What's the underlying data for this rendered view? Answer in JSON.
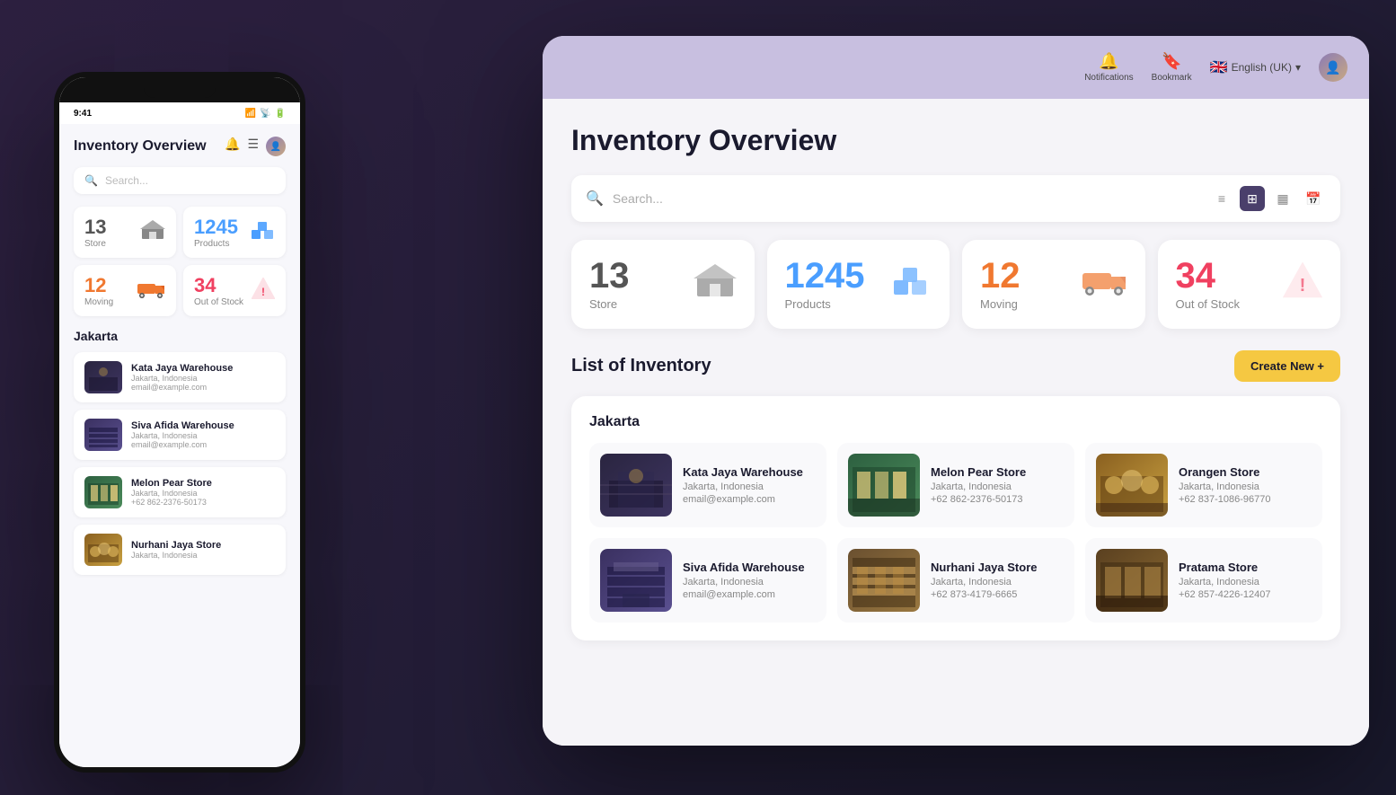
{
  "scene": {
    "background": "#1a1a2e"
  },
  "desktop": {
    "header": {
      "notifications_label": "Notifications",
      "bookmark_label": "Bookmark",
      "language": "English (UK)",
      "language_flag": "🇬🇧"
    },
    "page_title": "Inventory Overview",
    "search_placeholder": "Search...",
    "view_modes": [
      "list",
      "grid",
      "table",
      "calendar"
    ],
    "stats": [
      {
        "id": "store",
        "number": "13",
        "label": "Store",
        "color": "gray",
        "icon": "🏭"
      },
      {
        "id": "products",
        "number": "1245",
        "label": "Products",
        "color": "blue",
        "icon": "📦"
      },
      {
        "id": "moving",
        "number": "12",
        "label": "Moving",
        "color": "orange",
        "icon": "🚚"
      },
      {
        "id": "out-of-stock",
        "number": "34",
        "label": "Out of Stock",
        "color": "red",
        "icon": "⚠️"
      }
    ],
    "list_title": "List of Inventory",
    "create_button": "Create New +",
    "region": "Jakarta",
    "inventory_items": [
      {
        "id": 1,
        "name": "Kata Jaya Warehouse",
        "location": "Jakarta, Indonesia",
        "contact": "email@example.com",
        "thumb_type": "warehouse"
      },
      {
        "id": 2,
        "name": "Melon Pear Store",
        "location": "Jakarta, Indonesia",
        "contact": "+62 862-2376-50173",
        "thumb_type": "store"
      },
      {
        "id": 3,
        "name": "Orangen Store",
        "location": "Jakarta, Indonesia",
        "contact": "+62 837-1086-96770",
        "thumb_type": "market"
      },
      {
        "id": 4,
        "name": "Siva Afida Warehouse",
        "location": "Jakarta, Indonesia",
        "contact": "email@example.com",
        "thumb_type": "warehouse2"
      },
      {
        "id": 5,
        "name": "Nurhani Jaya Store",
        "location": "Jakarta, Indonesia",
        "contact": "+62 873-4179-6665",
        "thumb_type": "shelves"
      },
      {
        "id": 6,
        "name": "Pratama Store",
        "location": "Jakarta, Indonesia",
        "contact": "+62 857-4226-12407",
        "thumb_type": "market2"
      }
    ]
  },
  "mobile": {
    "page_title": "Inventory Overview",
    "search_placeholder": "Search...",
    "stats": [
      {
        "id": "store",
        "number": "13",
        "label": "Store",
        "color": "gray",
        "icon": "🏭"
      },
      {
        "id": "products",
        "number": "1245",
        "label": "Products",
        "color": "blue",
        "icon": "📦"
      },
      {
        "id": "moving",
        "number": "12",
        "label": "Moving",
        "color": "orange",
        "icon": "🚚"
      },
      {
        "id": "out-of-stock",
        "number": "34",
        "label": "Out of Stock",
        "color": "red",
        "icon": "⚠️"
      }
    ],
    "region": "Jakarta",
    "items": [
      {
        "id": 1,
        "name": "Kata Jaya Warehouse",
        "location": "Jakarta, Indonesia",
        "contact": "email@example.com",
        "thumb_type": "warehouse"
      },
      {
        "id": 2,
        "name": "Siva Afida Warehouse",
        "location": "Jakarta, Indonesia",
        "contact": "email@example.com",
        "thumb_type": "warehouse2"
      },
      {
        "id": 3,
        "name": "Melon Pear Store",
        "location": "Jakarta, Indonesia",
        "contact": "+62 862-2376-50173",
        "thumb_type": "store"
      },
      {
        "id": 4,
        "name": "Nurhani Jaya Store",
        "location": "Jakarta, Indonesia",
        "contact": "",
        "thumb_type": "market"
      }
    ]
  },
  "colors": {
    "gray": "#555555",
    "blue": "#4a9eff",
    "orange": "#f07830",
    "red": "#f04060",
    "accent_yellow": "#f5c842",
    "header_bg": "#c8bfe0",
    "card_bg": "#f5f4f8"
  }
}
